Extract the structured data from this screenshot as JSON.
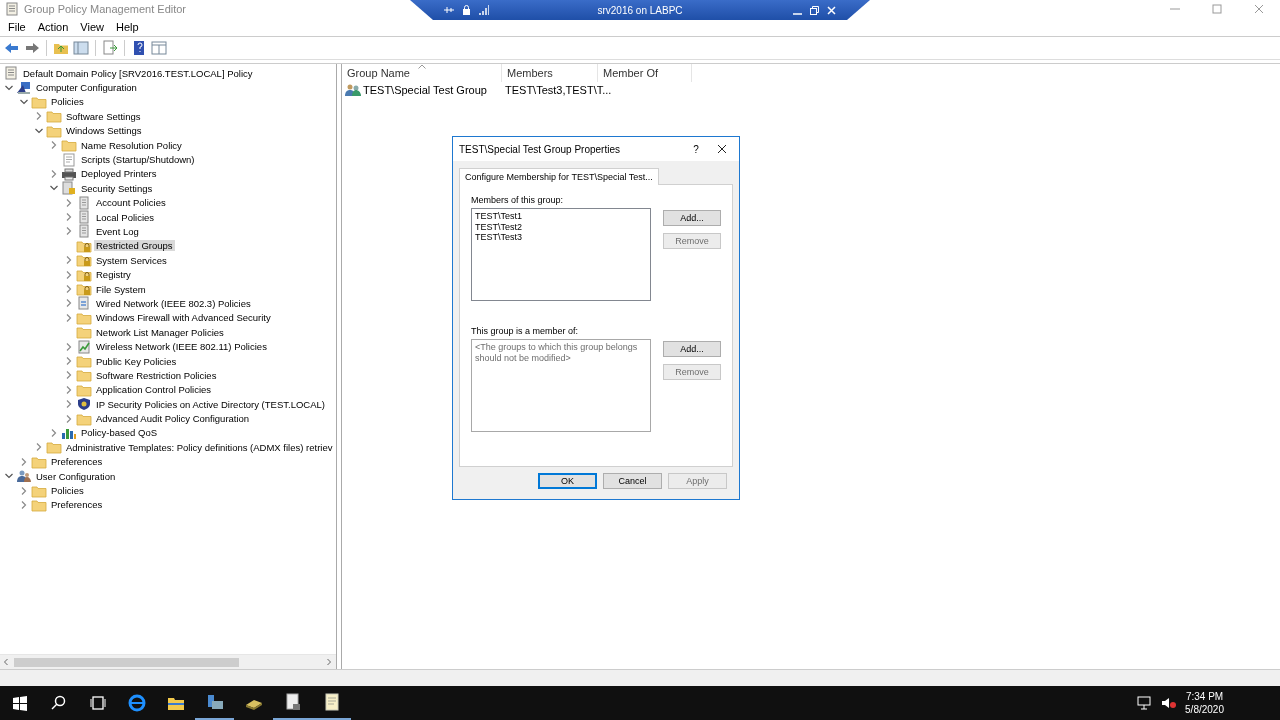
{
  "window": {
    "title": "Group Policy Management Editor"
  },
  "rdp_bar": {
    "title": "srv2016 on LABPC"
  },
  "menu": [
    "File",
    "Action",
    "View",
    "Help"
  ],
  "tree": [
    {
      "label": "Default Domain Policy [SRV2016.TEST.LOCAL] Policy",
      "kind": "policy",
      "selected": false,
      "children": [
        {
          "label": "Computer Configuration",
          "kind": "computer",
          "selected": false,
          "expanded": true,
          "children": [
            {
              "label": "Policies",
              "kind": "folder",
              "selected": false,
              "expanded": true,
              "children": [
                {
                  "label": "Software Settings",
                  "kind": "folder",
                  "selected": false,
                  "expanded": false
                },
                {
                  "label": "Windows Settings",
                  "kind": "folder",
                  "selected": false,
                  "expanded": true,
                  "children": [
                    {
                      "label": "Name Resolution Policy",
                      "kind": "folder",
                      "selected": false,
                      "expanded": false
                    },
                    {
                      "label": "Scripts (Startup/Shutdown)",
                      "kind": "script",
                      "selected": false
                    },
                    {
                      "label": "Deployed Printers",
                      "kind": "printer",
                      "selected": false,
                      "expanded": false
                    },
                    {
                      "label": "Security Settings",
                      "kind": "security",
                      "selected": false,
                      "expanded": true,
                      "children": [
                        {
                          "label": "Account Policies",
                          "kind": "server",
                          "selected": false,
                          "expanded": false
                        },
                        {
                          "label": "Local Policies",
                          "kind": "server",
                          "selected": false,
                          "expanded": false
                        },
                        {
                          "label": "Event Log",
                          "kind": "server",
                          "selected": false,
                          "expanded": false
                        },
                        {
                          "label": "Restricted Groups",
                          "kind": "lockfolder",
                          "selected": true
                        },
                        {
                          "label": "System Services",
                          "kind": "lockfolder",
                          "selected": false,
                          "expanded": false
                        },
                        {
                          "label": "Registry",
                          "kind": "lockfolder",
                          "selected": false,
                          "expanded": false
                        },
                        {
                          "label": "File System",
                          "kind": "lockfolder",
                          "selected": false,
                          "expanded": false
                        },
                        {
                          "label": "Wired Network (IEEE 802.3) Policies",
                          "kind": "network",
                          "selected": false,
                          "expanded": false
                        },
                        {
                          "label": "Windows Firewall with Advanced Security",
                          "kind": "folder",
                          "selected": false,
                          "expanded": false
                        },
                        {
                          "label": "Network List Manager Policies",
                          "kind": "folder",
                          "selected": false
                        },
                        {
                          "label": "Wireless Network (IEEE 802.11) Policies",
                          "kind": "wireless",
                          "selected": false,
                          "expanded": false
                        },
                        {
                          "label": "Public Key Policies",
                          "kind": "folder",
                          "selected": false,
                          "expanded": false
                        },
                        {
                          "label": "Software Restriction Policies",
                          "kind": "folder",
                          "selected": false,
                          "expanded": false
                        },
                        {
                          "label": "Application Control Policies",
                          "kind": "folder",
                          "selected": false,
                          "expanded": false
                        },
                        {
                          "label": "IP Security Policies on Active Directory (TEST.LOCAL)",
                          "kind": "shield",
                          "selected": false,
                          "expanded": false
                        },
                        {
                          "label": "Advanced Audit Policy Configuration",
                          "kind": "folder",
                          "selected": false,
                          "expanded": false
                        }
                      ]
                    },
                    {
                      "label": "Policy-based QoS",
                      "kind": "chart",
                      "selected": false,
                      "expanded": false
                    }
                  ]
                },
                {
                  "label": "Administrative Templates: Policy definitions (ADMX files) retriev",
                  "kind": "folder",
                  "selected": false,
                  "expanded": false
                }
              ]
            },
            {
              "label": "Preferences",
              "kind": "folder",
              "selected": false,
              "expanded": false
            }
          ]
        },
        {
          "label": "User Configuration",
          "kind": "user",
          "selected": false,
          "expanded": true,
          "children": [
            {
              "label": "Policies",
              "kind": "folder",
              "selected": false,
              "expanded": false
            },
            {
              "label": "Preferences",
              "kind": "folder",
              "selected": false,
              "expanded": false
            }
          ]
        }
      ]
    }
  ],
  "list": {
    "columns": [
      {
        "label": "Group Name",
        "sorted": true
      },
      {
        "label": "Members",
        "sorted": false
      },
      {
        "label": "Member Of",
        "sorted": false
      }
    ],
    "rows": [
      {
        "kind": "group",
        "cells": [
          "TEST\\Special Test Group",
          "TEST\\Test3,TEST\\T..."
        ]
      }
    ]
  },
  "dialog": {
    "title": "TEST\\Special Test Group Properties",
    "help": "?",
    "tabs": [
      {
        "label": "Configure Membership for TEST\\Special Test...",
        "selected": true
      }
    ],
    "members_label": "Members of this group:",
    "members": [
      "TEST\\Test1",
      "TEST\\Test2",
      "TEST\\Test3"
    ],
    "members_buttons": [
      {
        "label": "Add...",
        "disabled": false
      },
      {
        "label": "Remove",
        "disabled": true
      }
    ],
    "member_of_label": "This group is a member of:",
    "member_of_placeholder": "<The groups to which this group belongs should not be modified>",
    "member_of_buttons": [
      {
        "label": "Add...",
        "disabled": false
      },
      {
        "label": "Remove",
        "disabled": true
      }
    ],
    "footer_buttons": [
      {
        "label": "OK",
        "disabled": false,
        "default": true
      },
      {
        "label": "Cancel",
        "disabled": false,
        "default": false
      },
      {
        "label": "Apply",
        "disabled": true,
        "default": false
      }
    ]
  },
  "taskbar": {
    "apps": [
      {
        "kind": "start",
        "running": false
      },
      {
        "kind": "search",
        "running": false
      },
      {
        "kind": "taskview",
        "running": false
      },
      {
        "kind": "browser",
        "running": false
      },
      {
        "kind": "explorer",
        "running": false
      },
      {
        "kind": "server",
        "running": true
      },
      {
        "kind": "drive",
        "running": false
      },
      {
        "kind": "document",
        "running": true
      },
      {
        "kind": "notes",
        "running": true
      }
    ],
    "time": "7:34 PM",
    "date": "5/8/2020"
  }
}
